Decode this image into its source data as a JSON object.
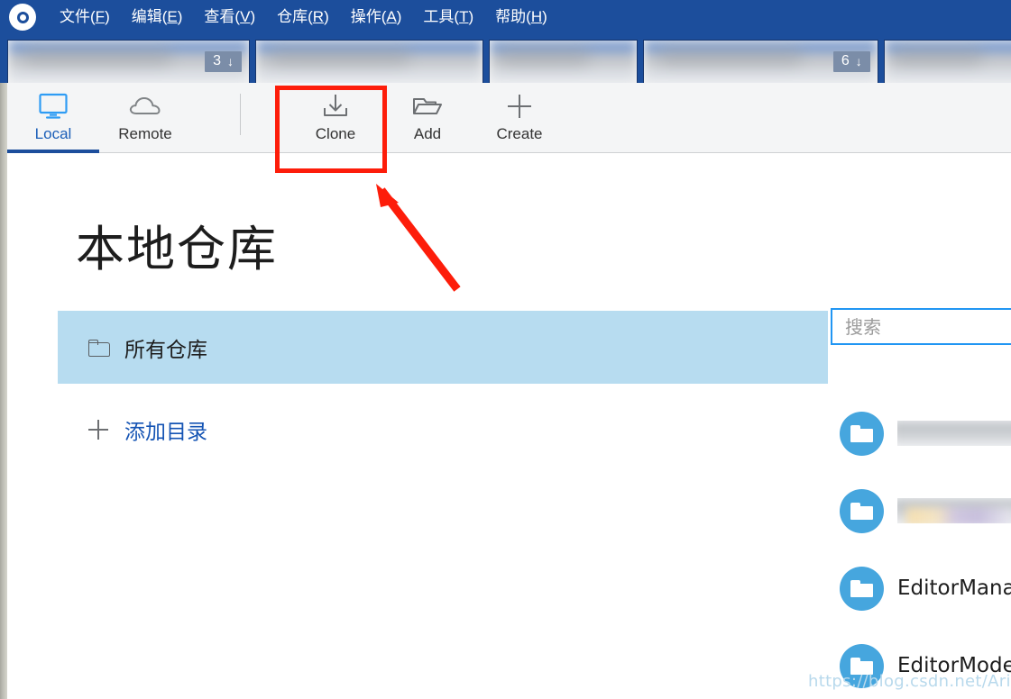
{
  "app": {
    "logo_icon": "app-circle-logo",
    "watermark": "https://blog.csdn.net/Aries_H"
  },
  "menubar": {
    "items": [
      {
        "label": "文件(F)",
        "text": "文件(",
        "accel": "F",
        "tail": ")"
      },
      {
        "label": "编辑(E)",
        "text": "编辑(",
        "accel": "E",
        "tail": ")"
      },
      {
        "label": "查看(V)",
        "text": "查看(",
        "accel": "V",
        "tail": ")"
      },
      {
        "label": "仓库(R)",
        "text": "仓库(",
        "accel": "R",
        "tail": ")"
      },
      {
        "label": "操作(A)",
        "text": "操作(",
        "accel": "A",
        "tail": ")"
      },
      {
        "label": "工具(T)",
        "text": "工具(",
        "accel": "T",
        "tail": ")"
      },
      {
        "label": "帮助(H)",
        "text": "帮助(",
        "accel": "H",
        "tail": ")"
      }
    ]
  },
  "tabstrip": {
    "tabs": [
      {
        "title": "",
        "badge": "3",
        "badge_arrow": "↓",
        "redacted": true
      },
      {
        "title": "",
        "badge": "",
        "badge_arrow": "",
        "redacted": true
      },
      {
        "title": "",
        "badge": "",
        "badge_arrow": "",
        "redacted": true
      },
      {
        "title": "",
        "badge": "6",
        "badge_arrow": "↓",
        "redacted": true
      },
      {
        "title": "",
        "badge": "",
        "badge_arrow": "",
        "redacted": true
      }
    ]
  },
  "toolbar": {
    "items": [
      {
        "label": "Local",
        "icon": "monitor-icon",
        "active": true
      },
      {
        "label": "Remote",
        "icon": "cloud-icon",
        "active": false
      },
      {
        "label": "Clone",
        "icon": "download-icon",
        "active": false
      },
      {
        "label": "Add",
        "icon": "folder-open-icon",
        "active": false
      },
      {
        "label": "Create",
        "icon": "plus-icon",
        "active": false
      }
    ]
  },
  "main": {
    "title": "本地仓库",
    "group": {
      "label": "所有仓库",
      "icon": "folder-icon",
      "selected": true
    },
    "add_directory": {
      "label": "添加目录",
      "icon": "plus-icon"
    }
  },
  "right_panel": {
    "search": {
      "value": "",
      "placeholder": "搜索"
    },
    "repositories": [
      {
        "name": "",
        "icon": "repo-folder-icon",
        "redacted": true,
        "tint": false
      },
      {
        "name": "",
        "icon": "repo-folder-icon",
        "redacted": true,
        "tint": true
      },
      {
        "name": "EditorMana",
        "icon": "repo-folder-icon",
        "redacted": false,
        "tint": false
      },
      {
        "name": "EditorMode",
        "icon": "repo-folder-icon",
        "redacted": false,
        "tint": false
      }
    ]
  },
  "annotations": {
    "highlight_box": {
      "target": "Clone",
      "color": "#fd1d0a"
    },
    "arrow": {
      "points_to": "Clone",
      "color": "#fd1d0a"
    }
  },
  "colors": {
    "menubar_bg": "#1c4e9c",
    "accent_blue": "#1554b4",
    "selection_blue": "#b7dcf0",
    "repo_icon_blue": "#46a6de",
    "annotation_red": "#fd1d0a"
  }
}
